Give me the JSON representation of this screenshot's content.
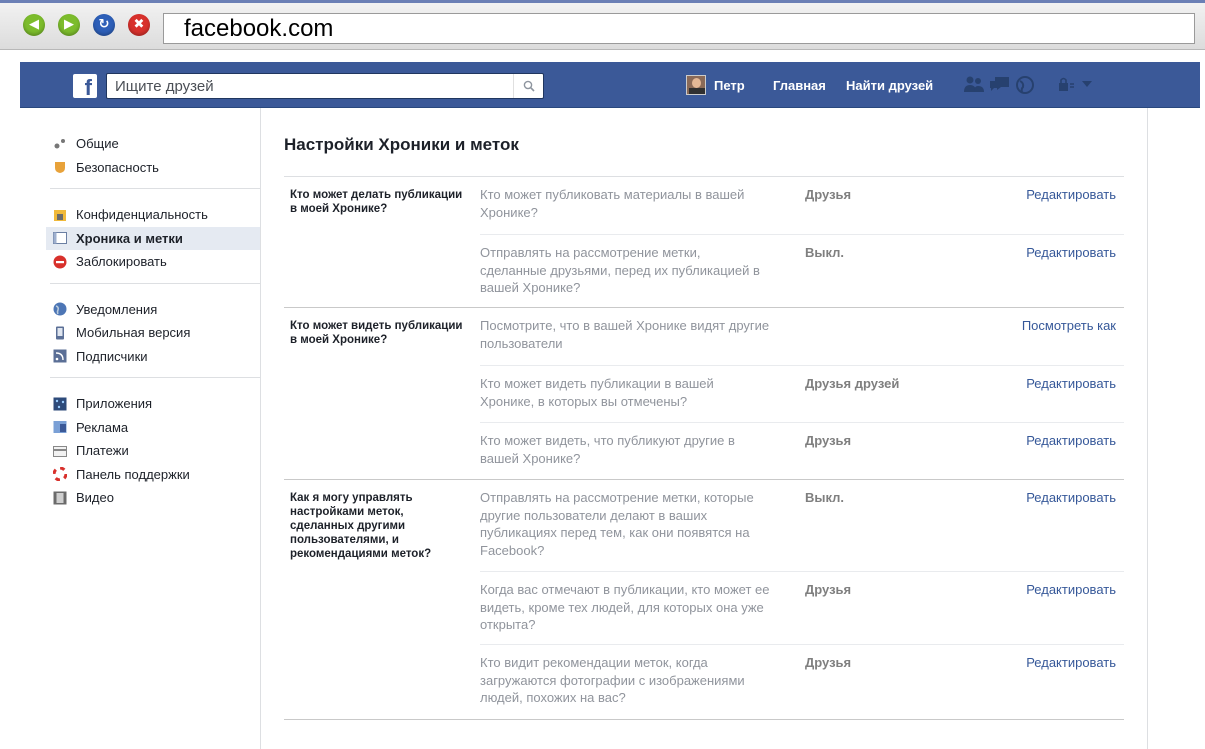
{
  "browser": {
    "url": "facebook.com"
  },
  "header": {
    "search_placeholder": "Ищите друзей",
    "user_name": "Петр",
    "nav_home": "Главная",
    "nav_find_friends": "Найти друзей"
  },
  "sidebar": {
    "groups": [
      [
        {
          "label": "Общие",
          "icon": "gears-icon"
        },
        {
          "label": "Безопасность",
          "icon": "shield-icon"
        }
      ],
      [
        {
          "label": "Конфиденциальность",
          "icon": "lock-icon"
        },
        {
          "label": "Хроника и метки",
          "icon": "timeline-icon",
          "active": true
        },
        {
          "label": "Заблокировать",
          "icon": "block-icon"
        }
      ],
      [
        {
          "label": "Уведомления",
          "icon": "globe-icon"
        },
        {
          "label": "Мобильная версия",
          "icon": "mobile-icon"
        },
        {
          "label": "Подписчики",
          "icon": "rss-icon"
        }
      ],
      [
        {
          "label": "Приложения",
          "icon": "apps-icon"
        },
        {
          "label": "Реклама",
          "icon": "ads-icon"
        },
        {
          "label": "Платежи",
          "icon": "card-icon"
        },
        {
          "label": "Панель поддержки",
          "icon": "lifebuoy-icon"
        },
        {
          "label": "Видео",
          "icon": "film-icon"
        }
      ]
    ]
  },
  "main": {
    "title": "Настройки Хроники и меток",
    "sections": [
      {
        "title": "Кто может делать публикации в моей Хронике?",
        "rows": [
          {
            "question": "Кто может публиковать материалы в вашей Хронике?",
            "value": "Друзья",
            "action": "Редактировать"
          },
          {
            "question": "Отправлять на рассмотрение метки, сделанные друзьями, перед их публикацией в вашей Хронике?",
            "value": "Выкл.",
            "action": "Редактировать"
          }
        ]
      },
      {
        "title": "Кто может видеть публикации в моей Хронике?",
        "rows": [
          {
            "question": "Посмотрите, что в вашей Хронике видят другие пользователи",
            "value": "",
            "action": "Посмотреть как"
          },
          {
            "question": "Кто может видеть публикации в вашей Хронике, в которых вы отмечены?",
            "value": "Друзья друзей",
            "action": "Редактировать"
          },
          {
            "question": "Кто может видеть, что публикуют другие в вашей Хронике?",
            "value": "Друзья",
            "action": "Редактировать"
          }
        ]
      },
      {
        "title": "Как я могу управлять настройками меток, сделанных другими пользователями, и рекомендациями меток?",
        "rows": [
          {
            "question": "Отправлять на рассмотрение метки, которые другие пользователи делают в ваших публикациях перед тем, как они появятся на Facebook?",
            "value": "Выкл.",
            "action": "Редактировать"
          },
          {
            "question": "Когда вас отмечают в публикации, кто может ее видеть, кроме тех людей, для которых она уже открыта?",
            "value": "Друзья",
            "action": "Редактировать"
          },
          {
            "question": "Кто видит рекомендации меток, когда загружаются фотографии с изображениями людей, похожих на вас?",
            "value": "Друзья",
            "action": "Редактировать"
          }
        ]
      }
    ]
  },
  "colors": {
    "brand_blue": "#3b5998",
    "link": "#365899",
    "sidebar_active": "#e5eaf2"
  }
}
